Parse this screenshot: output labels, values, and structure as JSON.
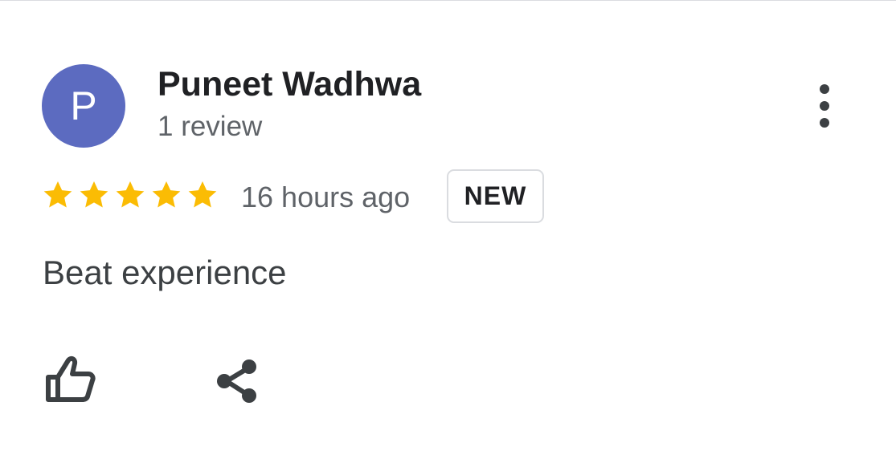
{
  "reviewer": {
    "avatar_initial": "P",
    "avatar_color": "#5c6bc0",
    "name": "Puneet Wadhwa",
    "review_count": "1 review"
  },
  "rating": {
    "stars": 5,
    "max_stars": 5,
    "star_color": "#fbbc04"
  },
  "time_ago": "16 hours ago",
  "badge_label": "NEW",
  "review_text": "Beat experience",
  "icons": {
    "more": "more-vert-icon",
    "like": "thumb-up-outline-icon",
    "share": "share-icon"
  }
}
